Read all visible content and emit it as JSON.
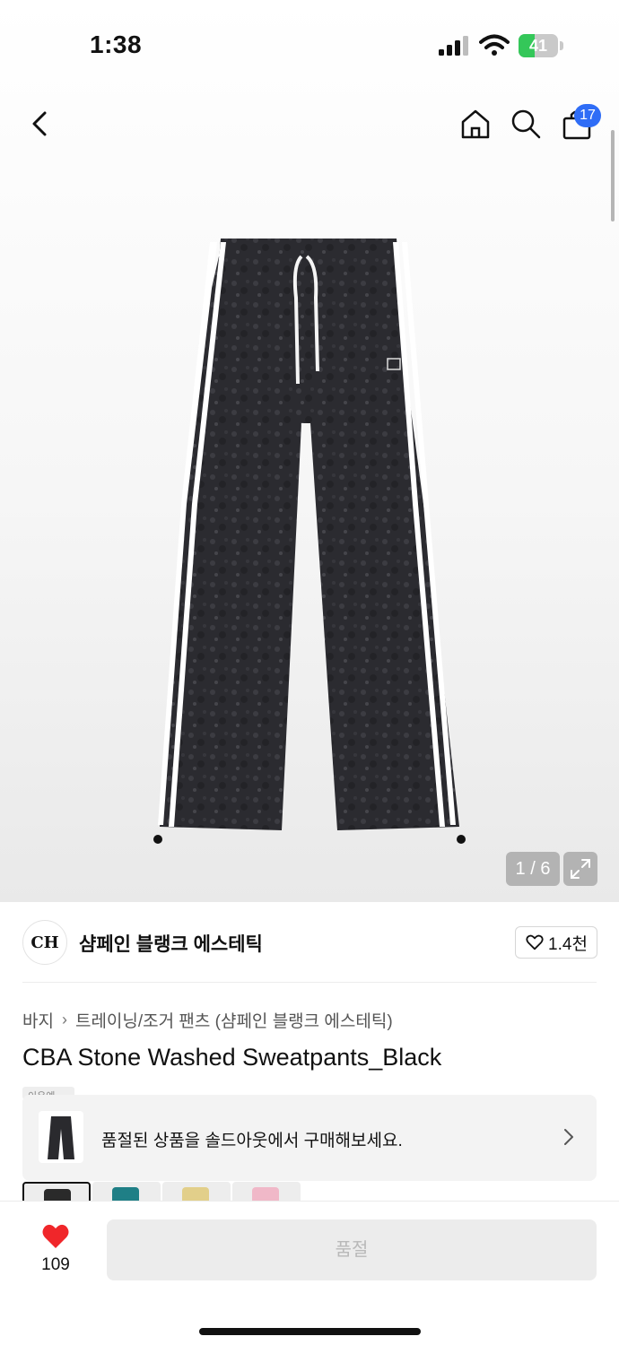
{
  "status_bar": {
    "time": "1:38",
    "battery_level": "41",
    "battery_fraction": 0.41,
    "battery_color": "#34c759"
  },
  "nav": {
    "back_icon": "chevron-left-icon",
    "home_icon": "home-icon",
    "search_icon": "search-icon",
    "cart_icon": "shopping-bag-icon",
    "cart_badge": "17",
    "badge_color": "#2f6df6"
  },
  "gallery": {
    "page_counter": "1 / 6",
    "expand_icon": "expand-icon"
  },
  "brand": {
    "logo_text": "CH",
    "name": "샴페인 블랭크 에스테틱",
    "like_count": "1.4천"
  },
  "breadcrumb": {
    "category": "바지",
    "subcategory": "트레이닝/조거 팬츠 (샴페인 블랭크 에스테틱)"
  },
  "product": {
    "title": "CBA Stone Washed Sweatpants_Black",
    "tag": "이유예"
  },
  "soldout_banner": {
    "text": "품절된 상품을 솔드아웃에서 구매해보세요."
  },
  "color_options": [
    {
      "swatch": "#2a2a2a",
      "selected": true
    },
    {
      "swatch": "#1f7f86",
      "selected": false
    },
    {
      "swatch": "#e2cf8a",
      "selected": false
    },
    {
      "swatch": "#f0b8c8",
      "selected": false
    }
  ],
  "bottom_bar": {
    "wish_count": "109",
    "wish_color": "#f0262a",
    "purchase_label": "품절"
  }
}
